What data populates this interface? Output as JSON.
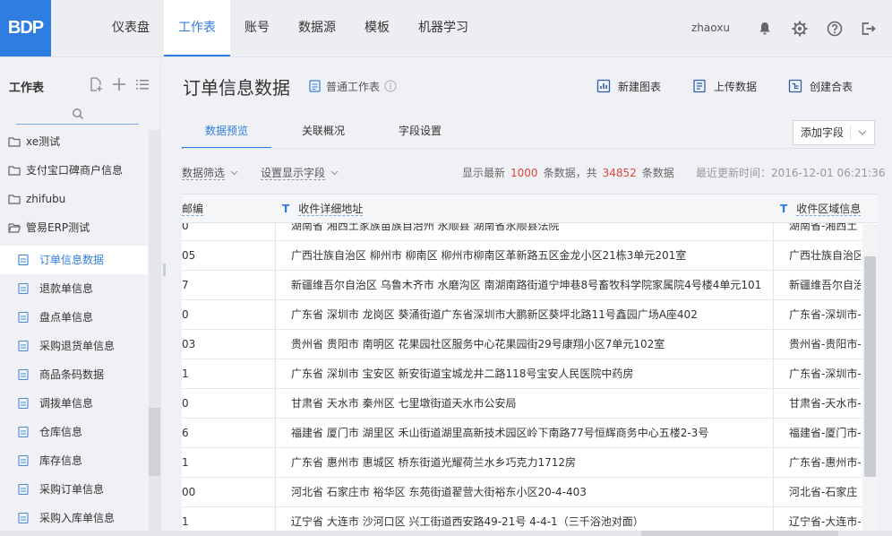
{
  "app": {
    "logo": "BDP"
  },
  "nav": {
    "tabs": [
      {
        "label": "仪表盘"
      },
      {
        "label": "工作表",
        "active": true
      },
      {
        "label": "账号"
      },
      {
        "label": "数据源"
      },
      {
        "label": "模板"
      },
      {
        "label": "机器学习"
      }
    ],
    "user": "zhaoxu",
    "icons": [
      "bell-icon",
      "gear-icon",
      "help-icon",
      "logout-icon"
    ]
  },
  "sidebar": {
    "title": "工作表",
    "folders": [
      {
        "label": "xe测试"
      },
      {
        "label": "支付宝口碑商户信息"
      },
      {
        "label": "zhifubu"
      },
      {
        "label": "管易ERP测试"
      }
    ],
    "sheets": [
      {
        "label": "订单信息数据",
        "active": true
      },
      {
        "label": "退款单信息"
      },
      {
        "label": "盘点单信息"
      },
      {
        "label": "采购退货单信息"
      },
      {
        "label": "商品条码数据"
      },
      {
        "label": "调拨单信息"
      },
      {
        "label": "仓库信息"
      },
      {
        "label": "库存信息"
      },
      {
        "label": "采购订单信息"
      },
      {
        "label": "采购入库单信息"
      }
    ]
  },
  "main": {
    "title": "订单信息数据",
    "sheet_type": "普通工作表",
    "actions": [
      {
        "label": "新建图表",
        "icon": "chart-icon"
      },
      {
        "label": "上传数据",
        "icon": "upload-icon"
      },
      {
        "label": "创建合表",
        "icon": "merge-icon"
      }
    ],
    "tabs": [
      {
        "label": "数据预览",
        "active": true
      },
      {
        "label": "关联概况"
      },
      {
        "label": "字段设置"
      }
    ],
    "add_field": "添加字段",
    "filter_label": "数据筛选",
    "display_fields_label": "设置显示字段",
    "stat": {
      "prefix": "显示最新",
      "shown": "1000",
      "middle": "条数据，共",
      "total": "34852",
      "suffix": "条数据"
    },
    "updated": "最近更新时间：2016-12-01 06:21:36"
  },
  "table": {
    "columns": [
      {
        "type": "",
        "label": "邮编"
      },
      {
        "type": "T",
        "label": "收件详细地址"
      },
      {
        "type": "T",
        "label": "收件区域信息"
      }
    ],
    "rows": [
      [
        "0",
        "湖南省 湘西土家族苗族自治州 永顺县 湖南省永顺县法院",
        "湖南省-湘西土"
      ],
      [
        "05",
        "广西壮族自治区 柳州市 柳南区 柳州市柳南区革新路五区金龙小区21栋3单元201室",
        "广西壮族自治区"
      ],
      [
        "7",
        "新疆维吾尔自治区 乌鲁木齐市 水磨沟区 南湖南路街道宁坤巷8号畜牧科学院家属院4号楼4单元101",
        "新疆维吾尔自治"
      ],
      [
        "0",
        "广东省 深圳市 龙岗区 葵涌街道广东省深圳市大鹏新区葵坪北路11号鑫园广场A座402",
        "广东省-深圳市-"
      ],
      [
        "03",
        "贵州省 贵阳市 南明区 花果园社区服务中心花果园街29号康翔小区7单元102室",
        "贵州省-贵阳市-"
      ],
      [
        "1",
        "广东省 深圳市 宝安区 新安街道宝城龙井二路118号宝安人民医院中药房",
        "广东省-深圳市-"
      ],
      [
        "0",
        "甘肃省 天水市 秦州区 七里墩街道天水市公安局",
        "甘肃省-天水市-"
      ],
      [
        "6",
        "福建省 厦门市 湖里区 禾山街道湖里高新技术园区岭下南路77号恒辉商务中心五楼2-3号",
        "福建省-厦门市-"
      ],
      [
        "1",
        "广东省 惠州市 惠城区 桥东街道光耀荷兰水乡巧克力1712房",
        "广东省-惠州市-"
      ],
      [
        "00",
        "河北省 石家庄市 裕华区 东苑街道翟营大街裕东小区20-4-403",
        "河北省-石家庄"
      ],
      [
        "1",
        "辽宁省 大连市 沙河口区 兴工街道西安路49-21号 4-4-1（三千浴池对面）",
        "辽宁省-大连市-"
      ]
    ]
  }
}
